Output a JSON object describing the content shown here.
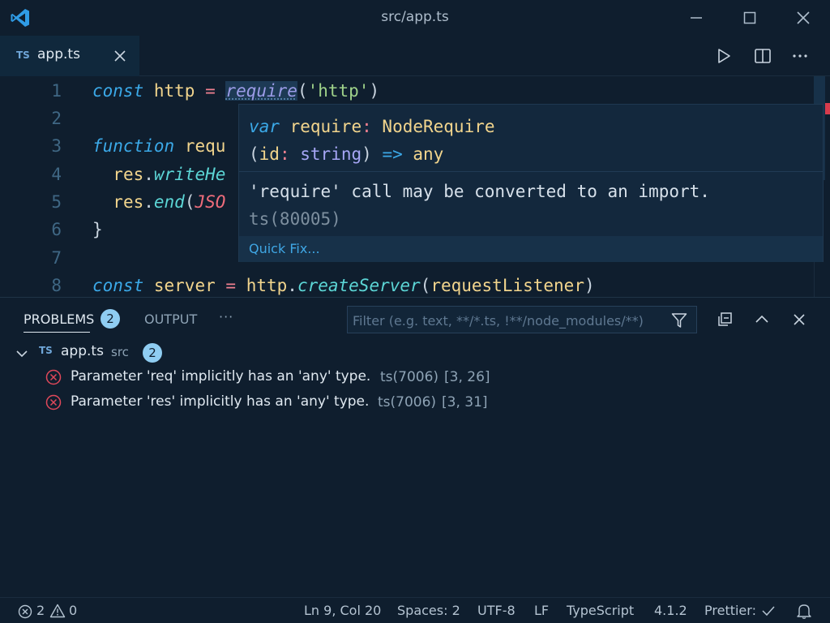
{
  "window": {
    "title": "src/app.ts",
    "logo_icon": "vscode-logo-icon",
    "controls": [
      "minimize-icon",
      "maximize-icon",
      "close-icon"
    ]
  },
  "tabs": [
    {
      "type_badge": "TS",
      "label": "app.ts",
      "active": true
    }
  ],
  "tab_actions": [
    "run-icon",
    "split-editor-icon",
    "more-actions-icon"
  ],
  "editor": {
    "lines": [
      {
        "n": "1"
      },
      {
        "n": "2"
      },
      {
        "n": "3"
      },
      {
        "n": "4"
      },
      {
        "n": "5"
      },
      {
        "n": "6"
      },
      {
        "n": "7"
      },
      {
        "n": "8"
      }
    ],
    "tokens": {
      "const": "const",
      "http": "http",
      "eq": "=",
      "require": "require",
      "paren_open": "(",
      "http_str": "'http'",
      "paren_close": ")",
      "function": "function",
      "requ": "requ",
      "res": "res",
      "dot": ".",
      "writeHe": "writeHe",
      "end": "end",
      "jso": "JSO",
      "brace_close": "}",
      "server": "server",
      "createServer": "createServer",
      "requestListener": "requestListener"
    }
  },
  "hover": {
    "sig_var": "var",
    "sig_name": "require",
    "sig_colon": ":",
    "sig_type": "NodeRequire",
    "sig_params_open": "(",
    "sig_param": "id",
    "sig_param_colon": ":",
    "sig_param_type": "string",
    "sig_params_close": ")",
    "sig_arrow": "=>",
    "sig_return": "any",
    "message": "'require' call may be converted to an import.",
    "code": "ts(80005)",
    "quick_fix": "Quick Fix..."
  },
  "panel": {
    "tabs": [
      {
        "label": "PROBLEMS",
        "badge": "2",
        "active": true
      },
      {
        "label": "OUTPUT"
      }
    ],
    "more": "···",
    "filter_placeholder": "Filter (e.g. text, **/*.ts, !**/node_modules/**)",
    "file": {
      "type_badge": "TS",
      "name": "app.ts",
      "folder": "src",
      "count": "2"
    },
    "problems": [
      {
        "message": "Parameter 'req' implicitly has an 'any' type.",
        "code": "ts(7006)",
        "position": "[3, 26]"
      },
      {
        "message": "Parameter 'res' implicitly has an 'any' type.",
        "code": "ts(7006)",
        "position": "[3, 31]"
      }
    ]
  },
  "status": {
    "errors": "2",
    "warnings": "0",
    "cursor": "Ln 9, Col 20",
    "indent": "Spaces: 2",
    "encoding": "UTF-8",
    "eol": "LF",
    "language": "TypeScript",
    "version": "4.1.2",
    "prettier": "Prettier:"
  },
  "colors": {
    "background": "#0f1e2e",
    "accent": "#3fa6e4",
    "error": "#d83b4c",
    "badge": "#8fcdf2"
  }
}
